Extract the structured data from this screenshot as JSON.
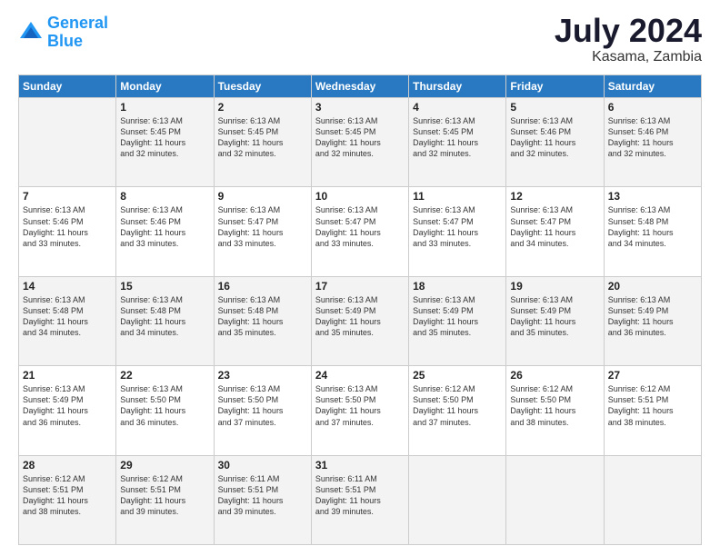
{
  "logo": {
    "line1": "General",
    "line2": "Blue"
  },
  "title": {
    "month_year": "July 2024",
    "location": "Kasama, Zambia"
  },
  "days_of_week": [
    "Sunday",
    "Monday",
    "Tuesday",
    "Wednesday",
    "Thursday",
    "Friday",
    "Saturday"
  ],
  "weeks": [
    [
      {
        "day": "",
        "info": ""
      },
      {
        "day": "1",
        "info": "Sunrise: 6:13 AM\nSunset: 5:45 PM\nDaylight: 11 hours\nand 32 minutes."
      },
      {
        "day": "2",
        "info": "Sunrise: 6:13 AM\nSunset: 5:45 PM\nDaylight: 11 hours\nand 32 minutes."
      },
      {
        "day": "3",
        "info": "Sunrise: 6:13 AM\nSunset: 5:45 PM\nDaylight: 11 hours\nand 32 minutes."
      },
      {
        "day": "4",
        "info": "Sunrise: 6:13 AM\nSunset: 5:45 PM\nDaylight: 11 hours\nand 32 minutes."
      },
      {
        "day": "5",
        "info": "Sunrise: 6:13 AM\nSunset: 5:46 PM\nDaylight: 11 hours\nand 32 minutes."
      },
      {
        "day": "6",
        "info": "Sunrise: 6:13 AM\nSunset: 5:46 PM\nDaylight: 11 hours\nand 32 minutes."
      }
    ],
    [
      {
        "day": "7",
        "info": "Sunrise: 6:13 AM\nSunset: 5:46 PM\nDaylight: 11 hours\nand 33 minutes."
      },
      {
        "day": "8",
        "info": "Sunrise: 6:13 AM\nSunset: 5:46 PM\nDaylight: 11 hours\nand 33 minutes."
      },
      {
        "day": "9",
        "info": "Sunrise: 6:13 AM\nSunset: 5:47 PM\nDaylight: 11 hours\nand 33 minutes."
      },
      {
        "day": "10",
        "info": "Sunrise: 6:13 AM\nSunset: 5:47 PM\nDaylight: 11 hours\nand 33 minutes."
      },
      {
        "day": "11",
        "info": "Sunrise: 6:13 AM\nSunset: 5:47 PM\nDaylight: 11 hours\nand 33 minutes."
      },
      {
        "day": "12",
        "info": "Sunrise: 6:13 AM\nSunset: 5:47 PM\nDaylight: 11 hours\nand 34 minutes."
      },
      {
        "day": "13",
        "info": "Sunrise: 6:13 AM\nSunset: 5:48 PM\nDaylight: 11 hours\nand 34 minutes."
      }
    ],
    [
      {
        "day": "14",
        "info": "Sunrise: 6:13 AM\nSunset: 5:48 PM\nDaylight: 11 hours\nand 34 minutes."
      },
      {
        "day": "15",
        "info": "Sunrise: 6:13 AM\nSunset: 5:48 PM\nDaylight: 11 hours\nand 34 minutes."
      },
      {
        "day": "16",
        "info": "Sunrise: 6:13 AM\nSunset: 5:48 PM\nDaylight: 11 hours\nand 35 minutes."
      },
      {
        "day": "17",
        "info": "Sunrise: 6:13 AM\nSunset: 5:49 PM\nDaylight: 11 hours\nand 35 minutes."
      },
      {
        "day": "18",
        "info": "Sunrise: 6:13 AM\nSunset: 5:49 PM\nDaylight: 11 hours\nand 35 minutes."
      },
      {
        "day": "19",
        "info": "Sunrise: 6:13 AM\nSunset: 5:49 PM\nDaylight: 11 hours\nand 35 minutes."
      },
      {
        "day": "20",
        "info": "Sunrise: 6:13 AM\nSunset: 5:49 PM\nDaylight: 11 hours\nand 36 minutes."
      }
    ],
    [
      {
        "day": "21",
        "info": "Sunrise: 6:13 AM\nSunset: 5:49 PM\nDaylight: 11 hours\nand 36 minutes."
      },
      {
        "day": "22",
        "info": "Sunrise: 6:13 AM\nSunset: 5:50 PM\nDaylight: 11 hours\nand 36 minutes."
      },
      {
        "day": "23",
        "info": "Sunrise: 6:13 AM\nSunset: 5:50 PM\nDaylight: 11 hours\nand 37 minutes."
      },
      {
        "day": "24",
        "info": "Sunrise: 6:13 AM\nSunset: 5:50 PM\nDaylight: 11 hours\nand 37 minutes."
      },
      {
        "day": "25",
        "info": "Sunrise: 6:12 AM\nSunset: 5:50 PM\nDaylight: 11 hours\nand 37 minutes."
      },
      {
        "day": "26",
        "info": "Sunrise: 6:12 AM\nSunset: 5:50 PM\nDaylight: 11 hours\nand 38 minutes."
      },
      {
        "day": "27",
        "info": "Sunrise: 6:12 AM\nSunset: 5:51 PM\nDaylight: 11 hours\nand 38 minutes."
      }
    ],
    [
      {
        "day": "28",
        "info": "Sunrise: 6:12 AM\nSunset: 5:51 PM\nDaylight: 11 hours\nand 38 minutes."
      },
      {
        "day": "29",
        "info": "Sunrise: 6:12 AM\nSunset: 5:51 PM\nDaylight: 11 hours\nand 39 minutes."
      },
      {
        "day": "30",
        "info": "Sunrise: 6:11 AM\nSunset: 5:51 PM\nDaylight: 11 hours\nand 39 minutes."
      },
      {
        "day": "31",
        "info": "Sunrise: 6:11 AM\nSunset: 5:51 PM\nDaylight: 11 hours\nand 39 minutes."
      },
      {
        "day": "",
        "info": ""
      },
      {
        "day": "",
        "info": ""
      },
      {
        "day": "",
        "info": ""
      }
    ]
  ]
}
